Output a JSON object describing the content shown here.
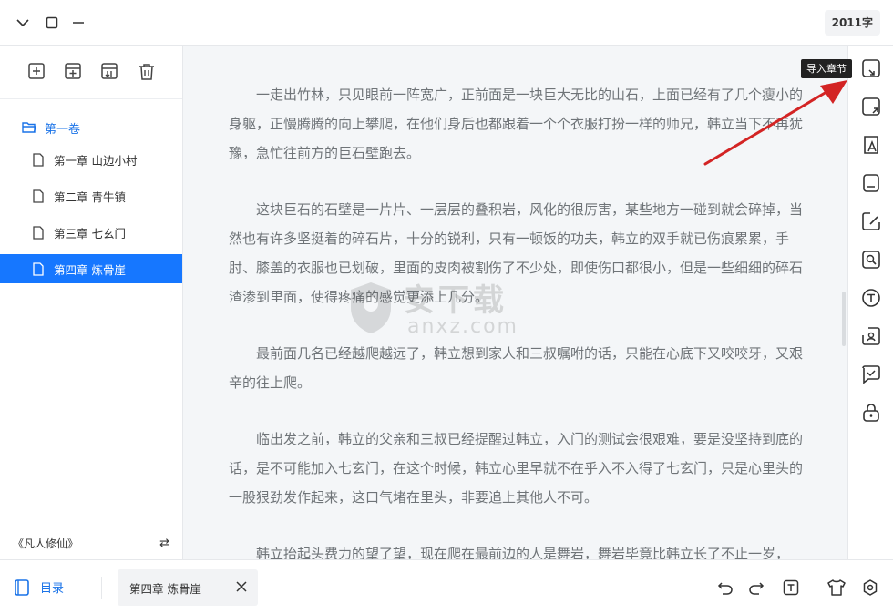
{
  "window": {
    "word_count": "2011字"
  },
  "sidebar": {
    "volume": "第一卷",
    "chapters": [
      {
        "label": "第一章 山边小村"
      },
      {
        "label": "第二章 青牛镇"
      },
      {
        "label": "第三章 七玄门"
      },
      {
        "label": "第四章 炼骨崖"
      }
    ],
    "active_index": 3,
    "book_title": "《凡人修仙》",
    "switch_glyph": "⇄"
  },
  "editor": {
    "paragraphs": [
      "一走出竹林，只见眼前一阵宽广，正前面是一块巨大无比的山石，上面已经有了几个瘦小的身躯，正慢腾腾的向上攀爬，在他们身后也都跟着一个个衣服打扮一样的师兄，韩立当下不再犹豫，急忙往前方的巨石壁跑去。",
      "这块巨石的石壁是一片片、一层层的叠积岩，风化的很厉害，某些地方一碰到就会碎掉，当然也有许多坚挺着的碎石片，十分的锐利，只有一顿饭的功夫，韩立的双手就已伤痕累累，手肘、膝盖的衣服也已划破，里面的皮肉被割伤了不少处，即使伤口都很小，但是一些细细的碎石渣渗到里面，使得疼痛的感觉更添上几分。",
      "最前面几名已经越爬越远了，韩立想到家人和三叔嘱咐的话，只能在心底下又咬咬牙，又艰辛的往上爬。",
      "临出发之前，韩立的父亲和三叔已经提醒过韩立，入门的测试会很艰难，要是没坚持到底的话，是不可能加入七玄门，在这个时候，韩立心里早就不在乎入不入得了七玄门，只是心里头的一股狠劲发作起来，这口气堵在里头，非要追上其他人不可。",
      "韩立抬起头费力的望了望，现在爬在最前边的人是舞岩，舞岩毕竟比韩立长了不止一岁，"
    ]
  },
  "watermark": {
    "text": "安下载",
    "domain": "anxz.com"
  },
  "tooltip": {
    "label": "导入章节"
  },
  "bottombar": {
    "toc_label": "目录",
    "open_tab_label": "第四章 炼骨崖"
  },
  "colors": {
    "accent": "#1677ff",
    "arrow": "#d32424"
  }
}
